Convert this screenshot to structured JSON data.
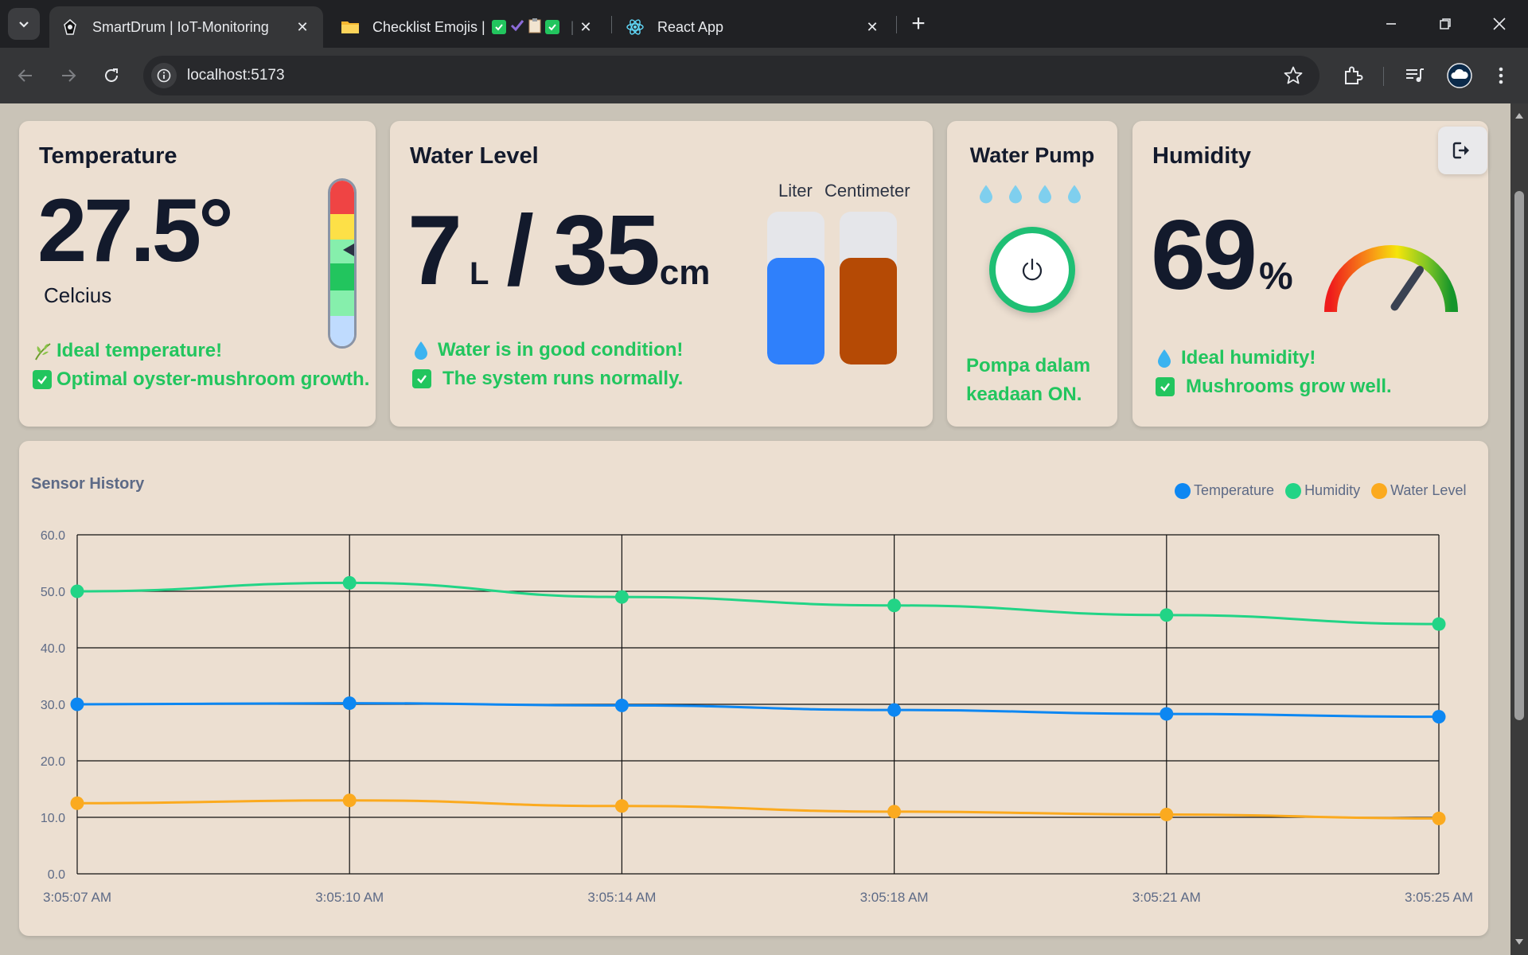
{
  "browser": {
    "tabs": [
      {
        "title": "SmartDrum | IoT-Monitoring",
        "active": true,
        "icon": "smartdrum-favicon"
      },
      {
        "title": "Checklist Emojis |",
        "active": false,
        "icon": "folder-favicon"
      },
      {
        "title": "React App",
        "active": false,
        "icon": "react-favicon"
      }
    ],
    "url": "localhost:5173"
  },
  "temperature": {
    "title": "Temperature",
    "value": "27.5°",
    "unit": "Celcius",
    "status_line1": "Ideal temperature!",
    "status_line2": "Optimal oyster-mushroom growth.",
    "scale_colors": [
      "#ef4444",
      "#fde047",
      "#86efac",
      "#22c55e",
      "#86efac",
      "#bfdbfe"
    ]
  },
  "water_level": {
    "title": "Water Level",
    "liters": "7",
    "liters_unit": "L",
    "separator": "/",
    "cm": "35",
    "cm_unit": "cm",
    "tube_label_liter": "Liter",
    "tube_label_cm": "Centimeter",
    "liter_fill_fraction": 0.7,
    "cm_fill_fraction": 0.7,
    "liter_color": "#2f80fb",
    "cm_color": "#b54a05",
    "status_line1": "Water is in good condition!",
    "status_line2": "The system runs normally."
  },
  "pump": {
    "title": "Water Pump",
    "state_line1": "Pompa dalam",
    "state_line2": "keadaan ON.",
    "state": "ON"
  },
  "humidity": {
    "title": "Humidity",
    "value": "69",
    "unit": "%",
    "gauge_fraction": 0.69,
    "status_line1": "Ideal humidity!",
    "status_line2": "Mushrooms grow well."
  },
  "colors": {
    "card_bg": "#ecdfd1",
    "page_bg": "#c9c3b7",
    "accent_green": "#22c55e",
    "text_dark": "#131a2c"
  },
  "chart_data": {
    "type": "line",
    "title": "Sensor History",
    "x": [
      "3:05:07 AM",
      "3:05:10 AM",
      "3:05:14 AM",
      "3:05:18 AM",
      "3:05:21 AM",
      "3:05:25 AM"
    ],
    "ylim": [
      0,
      60
    ],
    "yticks": [
      "0.0",
      "10.0",
      "20.0",
      "30.0",
      "40.0",
      "50.0",
      "60.0"
    ],
    "grid": true,
    "legend_position": "top-right",
    "series": [
      {
        "name": "Temperature",
        "color": "#0d87f2",
        "values": [
          30.0,
          30.2,
          29.8,
          29.0,
          28.3,
          27.8
        ]
      },
      {
        "name": "Humidity",
        "color": "#22d486",
        "values": [
          50.0,
          51.5,
          49.0,
          47.5,
          45.8,
          44.2
        ]
      },
      {
        "name": "Water Level",
        "color": "#fbaa1f",
        "values": [
          12.5,
          13.0,
          12.0,
          11.0,
          10.5,
          9.8
        ]
      }
    ]
  }
}
